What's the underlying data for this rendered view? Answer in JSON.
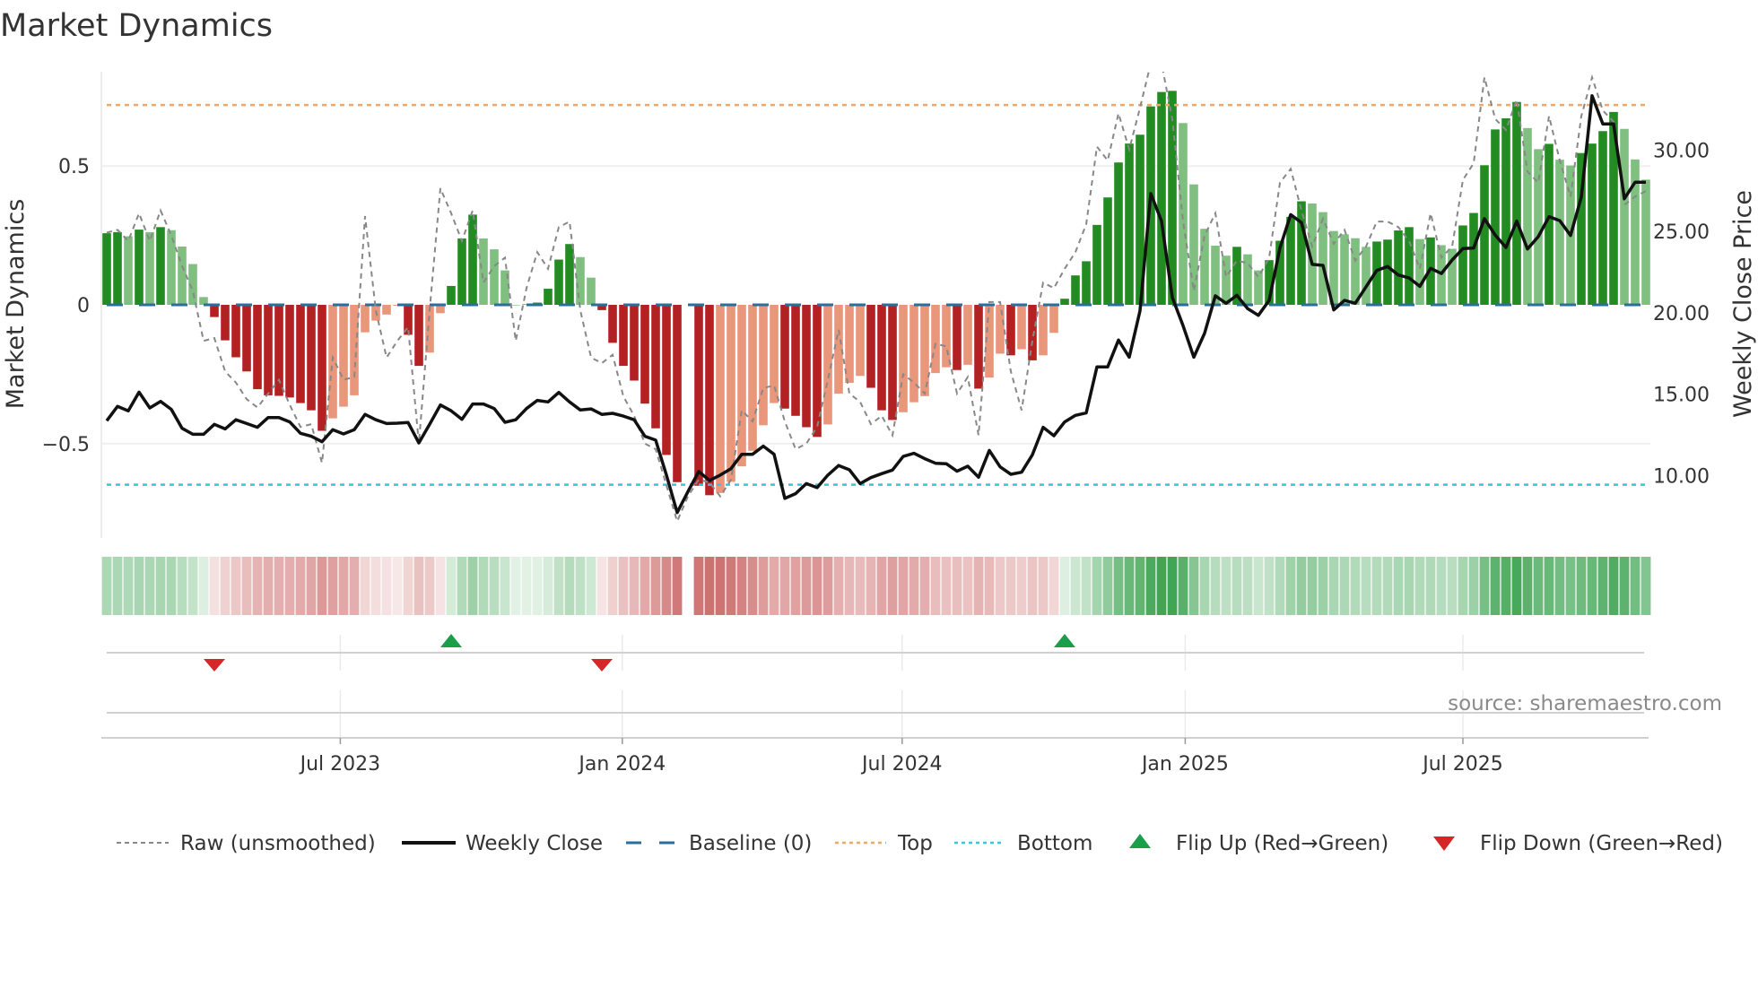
{
  "chart_data": {
    "type": "bar",
    "title": "Market Dynamics",
    "ylabel": "Market Dynamics",
    "y2label": "Weekly Close Price",
    "ylim": [
      -0.84,
      0.84
    ],
    "y2lim": [
      6.17,
      34.82
    ],
    "yticks": [
      {
        "value": 0.5,
        "label": "0.5"
      },
      {
        "value": 0,
        "label": "0"
      },
      {
        "value": -0.5,
        "label": "−0.5"
      }
    ],
    "y2ticks": [
      {
        "value": 30,
        "label": "30.00"
      },
      {
        "value": 25,
        "label": "25.00"
      },
      {
        "value": 20,
        "label": "20.00"
      },
      {
        "value": 15,
        "label": "15.00"
      },
      {
        "value": 10,
        "label": "10.00"
      }
    ],
    "xticks": [
      {
        "week": 21.7,
        "label": "Jul 2023"
      },
      {
        "week": 47.9,
        "label": "Jan 2024"
      },
      {
        "week": 73.9,
        "label": "Jul 2024"
      },
      {
        "week": 100.2,
        "label": "Jan 2025"
      },
      {
        "week": 126,
        "label": "Jul 2025"
      }
    ],
    "baseline": 0,
    "top": 0.72,
    "bottom": -0.648,
    "grid": true,
    "legend_placement": "bottom",
    "momentum": [
      0.258,
      0.262,
      0.247,
      0.271,
      0.262,
      0.28,
      0.269,
      0.21,
      0.147,
      0.028,
      -0.044,
      -0.128,
      -0.189,
      -0.24,
      -0.304,
      -0.326,
      -0.328,
      -0.334,
      -0.354,
      -0.38,
      -0.454,
      -0.409,
      -0.367,
      -0.326,
      -0.099,
      -0.057,
      -0.035,
      -0.003,
      -0.108,
      -0.22,
      -0.172,
      -0.03,
      0.068,
      0.239,
      0.325,
      0.239,
      0.2,
      0.124,
      0.0,
      0.003,
      0.008,
      0.058,
      0.163,
      0.219,
      0.172,
      0.098,
      -0.019,
      -0.137,
      -0.22,
      -0.273,
      -0.356,
      -0.445,
      -0.541,
      -0.639,
      null,
      -0.652,
      -0.686,
      -0.678,
      -0.638,
      -0.582,
      -0.526,
      -0.434,
      -0.354,
      -0.374,
      -0.4,
      -0.441,
      -0.476,
      -0.431,
      -0.32,
      -0.281,
      -0.256,
      -0.299,
      -0.38,
      -0.415,
      -0.387,
      -0.351,
      -0.329,
      -0.246,
      -0.225,
      -0.235,
      -0.216,
      -0.302,
      -0.262,
      -0.176,
      -0.182,
      -0.16,
      -0.2,
      -0.182,
      -0.101,
      0.022,
      0.106,
      0.157,
      0.288,
      0.387,
      0.513,
      0.581,
      0.613,
      0.715,
      0.767,
      0.771,
      0.655,
      0.434,
      0.274,
      0.213,
      0.177,
      0.209,
      0.182,
      0.124,
      0.161,
      0.231,
      0.317,
      0.373,
      0.365,
      0.334,
      0.266,
      0.254,
      0.24,
      0.209,
      0.228,
      0.235,
      0.268,
      0.28,
      0.237,
      0.243,
      0.215,
      0.202,
      0.286,
      0.331,
      0.503,
      0.632,
      0.672,
      0.731,
      0.637,
      0.561,
      0.58,
      0.523,
      0.502,
      0.547,
      0.581,
      0.626,
      0.695,
      0.634,
      0.524,
      0.451
    ],
    "strengthening": [
      1,
      1,
      0,
      1,
      0,
      1,
      0,
      0,
      0,
      0,
      1,
      1,
      1,
      1,
      1,
      1,
      1,
      1,
      1,
      1,
      1,
      0,
      0,
      0,
      0,
      0,
      0,
      0,
      1,
      1,
      0,
      0,
      1,
      1,
      1,
      0,
      0,
      0,
      0,
      0,
      1,
      1,
      1,
      1,
      0,
      0,
      1,
      1,
      1,
      1,
      1,
      1,
      1,
      1,
      0,
      1,
      1,
      0,
      0,
      0,
      0,
      0,
      0,
      1,
      1,
      1,
      1,
      0,
      0,
      0,
      0,
      1,
      1,
      1,
      0,
      0,
      0,
      0,
      0,
      1,
      0,
      1,
      0,
      0,
      1,
      0,
      1,
      0,
      0,
      1,
      1,
      1,
      1,
      1,
      1,
      1,
      1,
      1,
      1,
      1,
      0,
      0,
      0,
      0,
      0,
      1,
      0,
      0,
      1,
      1,
      1,
      1,
      0,
      0,
      0,
      0,
      0,
      0,
      1,
      1,
      1,
      1,
      0,
      1,
      0,
      0,
      1,
      1,
      1,
      1,
      1,
      1,
      0,
      0,
      1,
      0,
      0,
      1,
      1,
      1,
      1,
      0,
      0,
      0
    ],
    "raw": [
      0.26,
      0.27,
      0.23,
      0.33,
      0.23,
      0.34,
      0.25,
      0.14,
      0.05,
      -0.13,
      -0.12,
      -0.24,
      -0.28,
      -0.34,
      -0.37,
      -0.32,
      -0.27,
      -0.36,
      -0.44,
      -0.43,
      -0.57,
      -0.19,
      -0.27,
      -0.26,
      0.32,
      -0.02,
      -0.19,
      -0.13,
      -0.08,
      -0.5,
      -0.02,
      0.42,
      0.33,
      0.23,
      0.34,
      0.08,
      0.14,
      0.17,
      -0.13,
      0.06,
      0.19,
      0.13,
      0.28,
      0.3,
      -0.02,
      -0.19,
      -0.21,
      -0.18,
      -0.33,
      -0.4,
      -0.5,
      -0.52,
      -0.65,
      -0.78,
      -0.69,
      -0.63,
      -0.64,
      -0.69,
      -0.63,
      -0.38,
      -0.42,
      -0.3,
      -0.29,
      -0.42,
      -0.52,
      -0.5,
      -0.44,
      -0.27,
      -0.09,
      -0.32,
      -0.35,
      -0.43,
      -0.4,
      -0.47,
      -0.25,
      -0.28,
      -0.32,
      -0.14,
      -0.15,
      -0.32,
      -0.26,
      -0.47,
      0.01,
      0.01,
      -0.24,
      -0.38,
      -0.13,
      0.08,
      0.06,
      0.13,
      0.19,
      0.29,
      0.57,
      0.52,
      0.69,
      0.56,
      0.71,
      0.87,
      0.87,
      0.67,
      0.3,
      0.05,
      0.25,
      0.33,
      0.1,
      0.16,
      0.15,
      0.1,
      0.17,
      0.44,
      0.49,
      0.34,
      0.21,
      0.31,
      0.22,
      0.27,
      0.16,
      0.21,
      0.3,
      0.3,
      0.28,
      0.23,
      0.13,
      0.33,
      0.17,
      0.21,
      0.45,
      0.51,
      0.82,
      0.67,
      0.63,
      0.74,
      0.48,
      0.44,
      0.68,
      0.52,
      0.39,
      0.68,
      0.82,
      0.7,
      0.66,
      0.36,
      0.39,
      0.41
    ],
    "close": [
      13.37,
      14.25,
      13.98,
      15.13,
      14.16,
      14.56,
      14.07,
      12.91,
      12.54,
      12.54,
      13.15,
      12.87,
      13.43,
      13.2,
      12.97,
      13.57,
      13.57,
      13.3,
      12.6,
      12.42,
      12.08,
      12.82,
      12.56,
      12.82,
      13.76,
      13.43,
      13.2,
      13.22,
      13.26,
      12.01,
      13.15,
      14.34,
      13.98,
      13.46,
      14.4,
      14.4,
      14.12,
      13.28,
      13.43,
      14.12,
      14.62,
      14.53,
      15.11,
      14.53,
      14.03,
      14.1,
      13.76,
      13.83,
      13.66,
      13.43,
      12.42,
      12.18,
      10.03,
      7.73,
      9.02,
      10.25,
      9.7,
      10.03,
      10.43,
      11.31,
      11.31,
      11.81,
      11.31,
      8.6,
      8.89,
      9.51,
      9.26,
      10.03,
      10.62,
      10.36,
      9.51,
      9.88,
      10.12,
      10.34,
      11.18,
      11.37,
      11.04,
      10.76,
      10.73,
      10.27,
      10.58,
      9.9,
      11.55,
      10.54,
      10.08,
      10.21,
      11.28,
      12.97,
      12.45,
      13.3,
      13.7,
      13.85,
      16.68,
      16.68,
      18.33,
      17.28,
      20.13,
      27.33,
      25.64,
      20.95,
      19.21,
      17.28,
      18.75,
      21.05,
      20.59,
      21.08,
      20.26,
      19.85,
      20.77,
      23.99,
      26.04,
      25.55,
      22.98,
      22.92,
      20.18,
      20.77,
      20.59,
      21.6,
      22.61,
      22.85,
      22.33,
      22.15,
      21.63,
      22.74,
      22.42,
      23.25,
      23.95,
      23.99,
      25.79,
      24.78,
      24.02,
      25.64,
      23.93,
      24.68,
      25.91,
      25.67,
      24.76,
      27.11,
      33.35,
      31.61,
      31.61,
      27.02,
      28.03,
      28.03
    ],
    "flips": [
      {
        "week": 10,
        "type": "down"
      },
      {
        "week": 32,
        "type": "up"
      },
      {
        "week": 46,
        "type": "down"
      },
      {
        "week": 89,
        "type": "up"
      }
    ],
    "legend": [
      "Raw (unsmoothed)",
      "Weekly Close",
      "Baseline (0)",
      "Top",
      "Bottom",
      "Flip Up (Red→Green)",
      "Flip Down (Green→Red)"
    ],
    "annotation": "source: sharemaestro.com"
  },
  "colors": {
    "up_strong": "#228b22",
    "up_weak": "#7fbf7f",
    "down_strong": "#b22222",
    "down_weak": "#e9967a",
    "raw": "#888888",
    "close": "#111111",
    "baseline": "#2a6f9b",
    "top": "#f0a868",
    "bottom": "#3bc4d8",
    "flip_up": "#1a9e4a",
    "flip_down": "#d62728"
  }
}
